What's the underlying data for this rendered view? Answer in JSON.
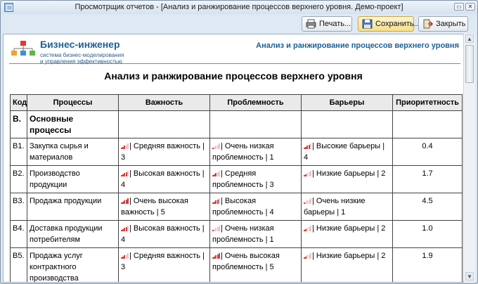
{
  "window": {
    "title": "Просмотрщик отчетов - [Анализ и ранжирование процессов верхнего уровня. Демо-проект]",
    "buttons": {
      "restore": "▭",
      "close": "✕"
    }
  },
  "toolbar": {
    "print": "Печать...",
    "save": "Сохранить...",
    "close": "Закрыть"
  },
  "report": {
    "brand": "Бизнес-инженер",
    "tagline_1": "система бизнес-моделирования",
    "tagline_2": "и управления эффективностью",
    "header_right": "Анализ и ранжирование процессов верхнего уровня",
    "title": "Анализ и ранжирование процессов верхнего уровня",
    "columns": [
      "Код",
      "Процессы",
      "Важность",
      "Проблемность",
      "Барьеры",
      "Приоритетность"
    ],
    "section": {
      "code": "В.",
      "name": "Основные процессы"
    },
    "rows": [
      {
        "code": "В1.",
        "process": "Закупка сырья и материалов",
        "importance": "| Средняя важность | 3",
        "imp_level": 3,
        "problem": "| Очень низкая проблемность | 1",
        "prob_level": 1,
        "barrier": "| Высокие барьеры | 4",
        "bar_level": 4,
        "priority": "0.4"
      },
      {
        "code": "В2.",
        "process": "Производство продукции",
        "importance": "| Высокая важность | 4",
        "imp_level": 4,
        "problem": "| Средняя проблемность | 3",
        "prob_level": 3,
        "barrier": "| Низкие барьеры | 2",
        "bar_level": 2,
        "priority": "1.7"
      },
      {
        "code": "В3.",
        "process": "Продажа продукции",
        "importance": "| Очень высокая важность | 5",
        "imp_level": 5,
        "problem": "| Высокая проблемность | 4",
        "prob_level": 4,
        "barrier": "| Очень низкие барьеры | 1",
        "bar_level": 1,
        "priority": "4.5"
      },
      {
        "code": "В4.",
        "process": "Доставка продукции потребителям",
        "importance": "| Высокая важность | 4",
        "imp_level": 4,
        "problem": "| Очень низкая проблемность | 1",
        "prob_level": 1,
        "barrier": "| Низкие барьеры | 2",
        "bar_level": 2,
        "priority": "1.0"
      },
      {
        "code": "В5.",
        "process": "Продажа услуг контрактного производства",
        "importance": "| Средняя важность | 3",
        "imp_level": 3,
        "problem": "| Очень высокая проблемность | 5",
        "prob_level": 5,
        "barrier": "| Низкие барьеры | 2",
        "bar_level": 2,
        "priority": "1.9"
      }
    ]
  },
  "colors": {
    "accent": "#1c5f97",
    "bar_on": "#d64040",
    "bar_off": "#efc7c7"
  }
}
